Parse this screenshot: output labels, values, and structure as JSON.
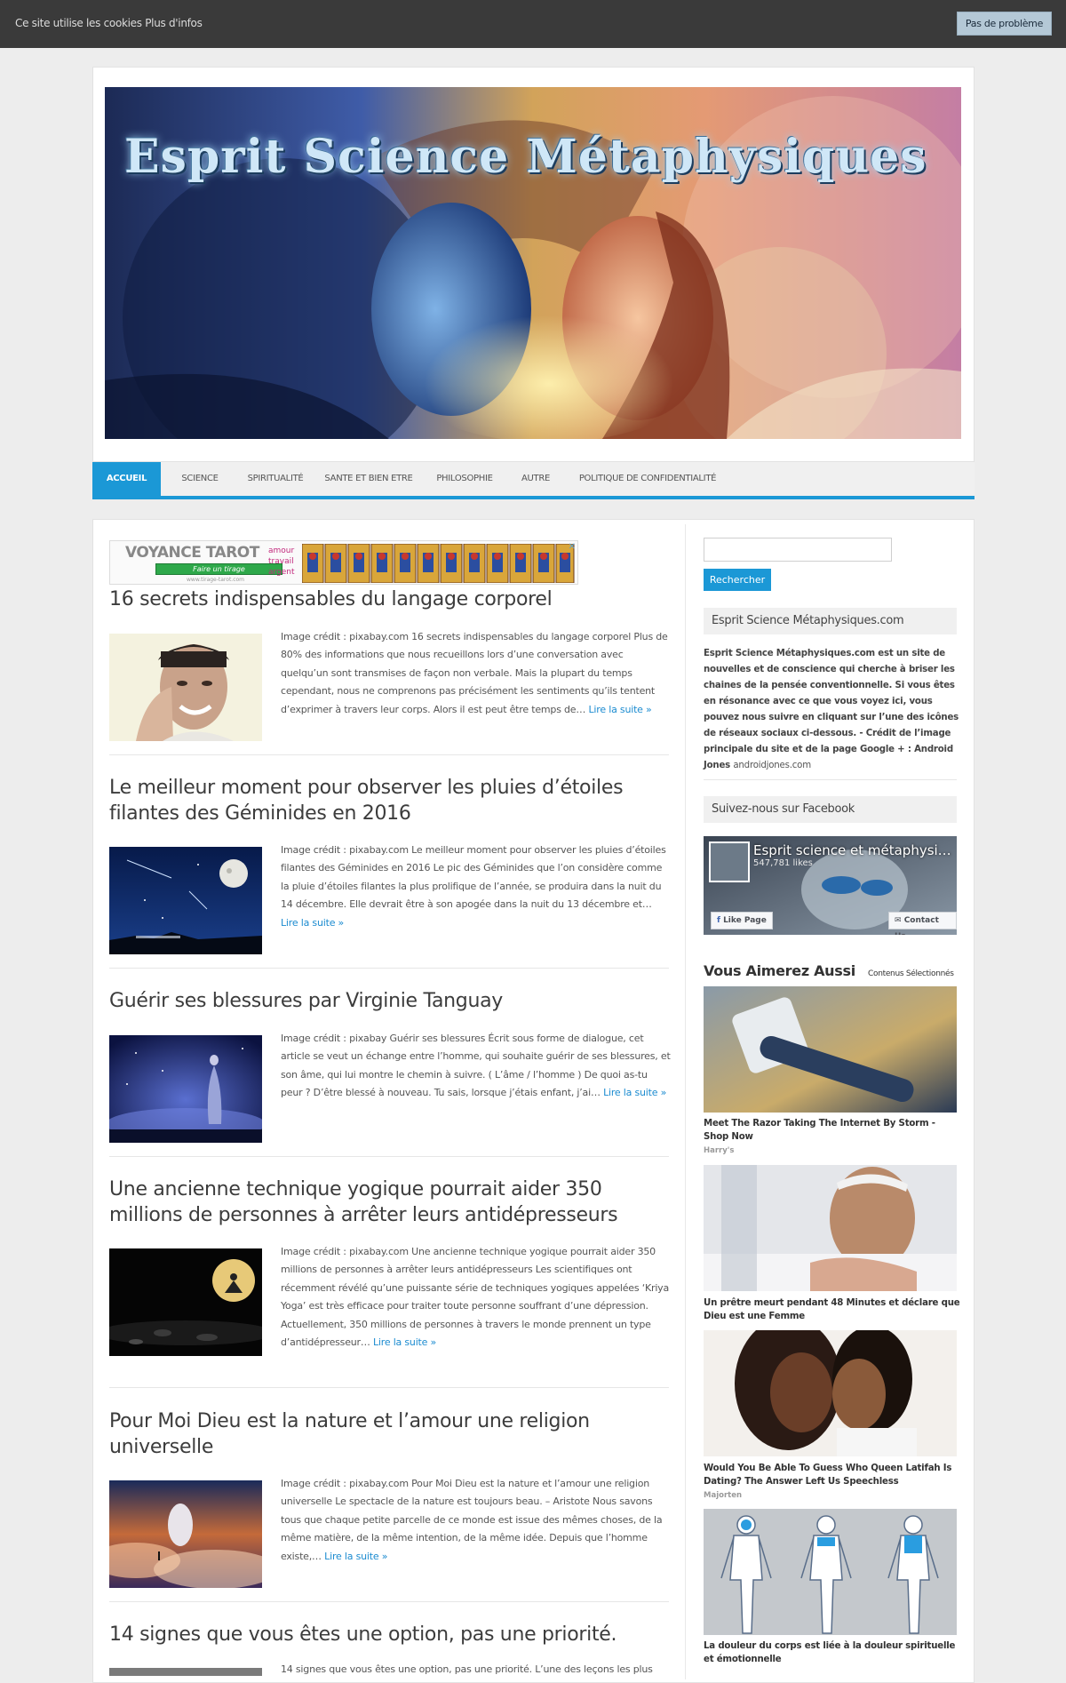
{
  "cookie_bar": {
    "text": "Ce site utilise les cookies Plus d'infos",
    "button": "Pas de problème"
  },
  "header": {
    "site_title": "Esprit Science Métaphysiques"
  },
  "nav": {
    "items": [
      "ACCUEIL",
      "SCIENCE",
      "SPIRITUALITÉ",
      "SANTE ET BIEN ETRE",
      "PHILOSOPHIE",
      "AUTRE",
      "POLITIQUE DE CONFIDENTIALITÉ"
    ],
    "active": "ACCUEIL"
  },
  "ad": {
    "title": "VOYANCE TAROT",
    "button": "Faire un tirage",
    "url": "www.tirage-tarot.com",
    "words": [
      "amour",
      "travail",
      "argent"
    ],
    "close": "✕"
  },
  "posts": [
    {
      "title": "16 secrets indispensables du langage corporel",
      "excerpt": "Image crédit : pixabay.com 16 secrets indispensables du langage corporel Plus de 80% des informations que nous recueillons lors d’une conversation avec quelqu’un sont transmises de façon non verbale. Mais la plupart du temps cependant, nous ne comprenons pas précisément les sentiments qu’ils tentent d’exprimer à travers leur corps. Alors il est peut être temps de… ",
      "more": "Lire la suite »"
    },
    {
      "title": "Le meilleur moment pour observer les pluies d’étoiles filantes des Géminides en 2016",
      "excerpt": "Image crédit : pixabay.com Le meilleur moment pour observer les pluies d’étoiles filantes des Géminides en 2016 Le pic des Géminides que l’on considère comme la pluie d’étoiles filantes la plus prolifique de l’année, se produira dans la nuit du 14 décembre. Elle devrait être à son apogée dans la nuit du 13 décembre et… ",
      "more": "Lire la suite »"
    },
    {
      "title": "Guérir ses blessures par Virginie Tanguay",
      "excerpt": "Image crédit : pixabay Guérir ses blessures Écrit sous forme de dialogue, cet article se veut un échange entre l’homme, qui souhaite guérir de ses blessures, et son âme, qui lui montre le chemin à suivre.  ( L’âme / l’homme ) De quoi as-tu peur ? D’être blessé à nouveau.  Tu sais, lorsque j’étais enfant, j’ai… ",
      "more": "Lire la suite »"
    },
    {
      "title": "Une ancienne technique yogique pourrait aider 350 millions de personnes à arrêter leurs antidépresseurs",
      "excerpt": " Image crédit : pixabay.com Une ancienne technique yogique pourrait aider 350 millions de personnes à arrêter leurs antidépresseurs Les scientifiques ont récemment révélé qu’une puissante série de techniques yogiques appelées ‘Kriya Yoga’ est très efficace pour traiter toute personne souffrant d’une dépression. Actuellement, 350 millions de personnes à travers le monde prennent un type d’antidépresseur… ",
      "more": "Lire la suite »"
    },
    {
      "title": "Pour Moi Dieu est la nature et l’amour une religion universelle",
      "excerpt": "Image crédit : pixabay.com Pour Moi Dieu est la nature et l’amour une religion universelle Le spectacle de la nature est toujours beau.  – Aristote Nous savons tous que chaque petite parcelle de ce monde est issue des mêmes choses, de la même matière, de la même intention, de la même idée. Depuis que l’homme existe,… ",
      "more": "Lire la suite »"
    },
    {
      "title": "14 signes que vous êtes une option, pas une priorité.",
      "excerpt": " 14 signes que vous êtes une option, pas une priorité. L’une des leçons les plus",
      "more": ""
    }
  ],
  "sidebar": {
    "search_button": "Rechercher",
    "about_title": "Esprit Science Métaphysiques.com",
    "about_text": "Esprit Science Métaphysiques.com est un site de nouvelles et de conscience qui cherche à briser les chaines de la pensée conventionnelle. Si vous êtes en résonance avec ce que vous voyez ici, vous pouvez nous suivre en cliquant sur l’une des icônes de réseaux sociaux ci-dessous. - Crédit de l’image principale du site et de la page Google + :  Android Jones ",
    "about_link": "androidjones.com",
    "facebook_title": "Suivez-nous sur Facebook",
    "fb_page_name": "Esprit science et métaphysi…",
    "fb_likes": "547,781 likes",
    "fb_like_button": "Like Page",
    "fb_contact_button": "Contact Us",
    "reco_title": "Vous Aimerez Aussi",
    "reco_sub": "Contenus Sélectionnés",
    "reco": [
      {
        "caption": "Meet The Razor Taking The Internet By Storm - Shop Now",
        "source": "Harry's"
      },
      {
        "caption": "Un prêtre meurt pendant 48 Minutes et déclare que Dieu est une Femme",
        "source": ""
      },
      {
        "caption": "Would You Be Able To Guess Who Queen Latifah Is Dating? The Answer Left Us Speechless",
        "source": "Majorten"
      },
      {
        "caption": "La douleur du corps est liée à la douleur spirituelle et émotionnelle",
        "source": ""
      }
    ]
  }
}
